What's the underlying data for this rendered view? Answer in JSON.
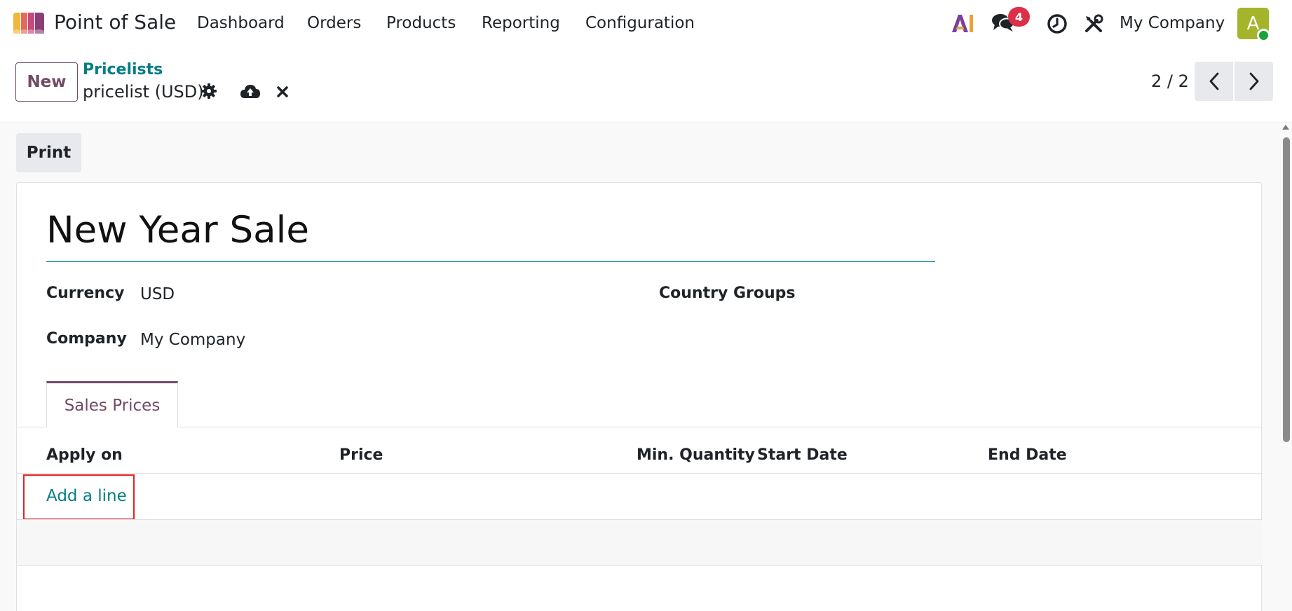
{
  "navbar": {
    "app_name": "Point of Sale",
    "menu": [
      "Dashboard",
      "Orders",
      "Products",
      "Reporting",
      "Configuration"
    ],
    "icons": [
      "app-logo-icon",
      "ai-icon",
      "chat-icon",
      "clock-icon",
      "tools-icon"
    ],
    "messages_badge": "4",
    "company": "My Company",
    "avatar_letter": "A",
    "colors": {
      "badge": "#dc2f4a",
      "avatar": "#a4b52c",
      "presence": "#1aa33a"
    }
  },
  "control_panel": {
    "new_label": "New",
    "breadcrumb": "Pricelists",
    "record_name": "pricelist (USD)",
    "icons": [
      "gear-icon",
      "cloud-upload-icon",
      "close-icon",
      "chevron-left-icon",
      "chevron-right-icon"
    ],
    "pager": "2 / 2"
  },
  "form": {
    "print_label": "Print",
    "title": "New Year Sale",
    "fields": {
      "currency_label": "Currency",
      "currency_value": "USD",
      "company_label": "Company",
      "company_value": "My Company",
      "country_groups_label": "Country Groups"
    },
    "tabs": [
      "Sales Prices"
    ],
    "table": {
      "columns": [
        "Apply on",
        "Price",
        "Min. Quantity",
        "Start Date",
        "End Date"
      ],
      "rows": [],
      "add_line": "Add a line"
    }
  },
  "theme": {
    "primary": "#714b67",
    "link": "#017e84",
    "highlight_box": "#e02424"
  }
}
